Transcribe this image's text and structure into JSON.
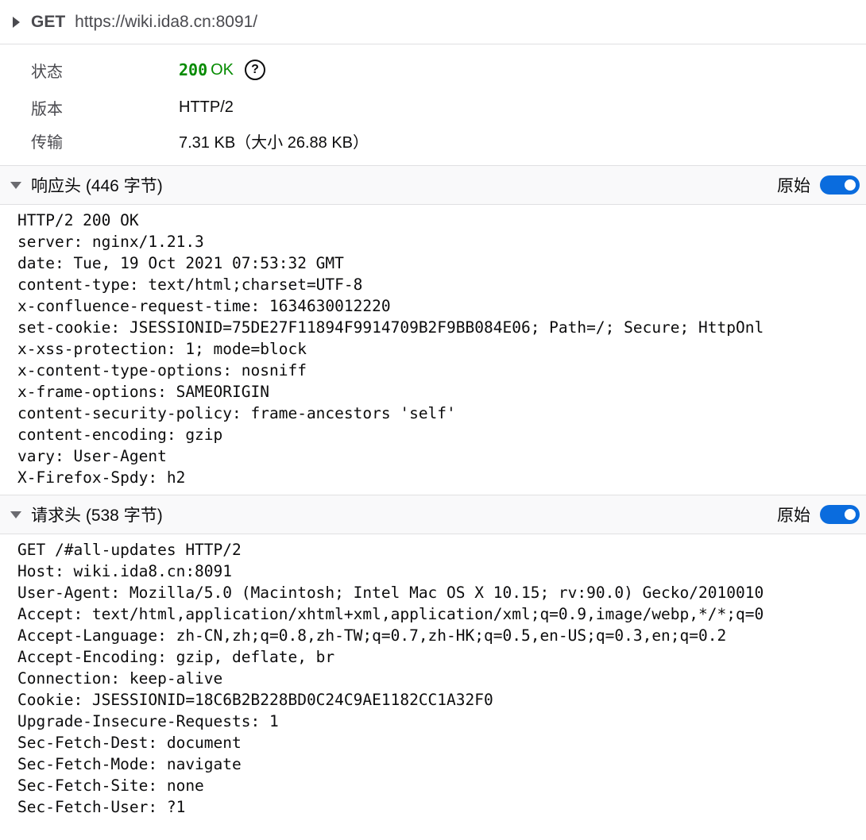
{
  "request": {
    "method": "GET",
    "url": "https://wiki.ida8.cn:8091/"
  },
  "summary": {
    "status_label": "状态",
    "status_code": "200",
    "status_text": "OK",
    "help_glyph": "?",
    "version_label": "版本",
    "version_value": "HTTP/2",
    "transfer_label": "传输",
    "transfer_value": "7.31 KB（大小 26.88 KB）"
  },
  "response_headers": {
    "title": "响应头 (446 字节)",
    "raw_label": "原始",
    "raw_enabled": true,
    "lines": [
      "HTTP/2 200 OK",
      "server: nginx/1.21.3",
      "date: Tue, 19 Oct 2021 07:53:32 GMT",
      "content-type: text/html;charset=UTF-8",
      "x-confluence-request-time: 1634630012220",
      "set-cookie: JSESSIONID=75DE27F11894F9914709B2F9BB084E06; Path=/; Secure; HttpOnl",
      "x-xss-protection: 1; mode=block",
      "x-content-type-options: nosniff",
      "x-frame-options: SAMEORIGIN",
      "content-security-policy: frame-ancestors 'self'",
      "content-encoding: gzip",
      "vary: User-Agent",
      "X-Firefox-Spdy: h2"
    ]
  },
  "request_headers": {
    "title": "请求头 (538 字节)",
    "raw_label": "原始",
    "raw_enabled": true,
    "lines": [
      "GET /#all-updates HTTP/2",
      "Host: wiki.ida8.cn:8091",
      "User-Agent: Mozilla/5.0 (Macintosh; Intel Mac OS X 10.15; rv:90.0) Gecko/2010010",
      "Accept: text/html,application/xhtml+xml,application/xml;q=0.9,image/webp,*/*;q=0",
      "Accept-Language: zh-CN,zh;q=0.8,zh-TW;q=0.7,zh-HK;q=0.5,en-US;q=0.3,en;q=0.2",
      "Accept-Encoding: gzip, deflate, br",
      "Connection: keep-alive",
      "Cookie: JSESSIONID=18C6B2B228BD0C24C9AE1182CC1A32F0",
      "Upgrade-Insecure-Requests: 1",
      "Sec-Fetch-Dest: document",
      "Sec-Fetch-Mode: navigate",
      "Sec-Fetch-Site: none",
      "Sec-Fetch-User: ?1"
    ]
  },
  "colors": {
    "status_ok": "#058b00",
    "toggle_on": "#0a6cde"
  },
  "icons": {
    "request_expand": "triangle-right-icon",
    "section_collapse": "triangle-down-icon",
    "help": "question-circle-icon"
  }
}
